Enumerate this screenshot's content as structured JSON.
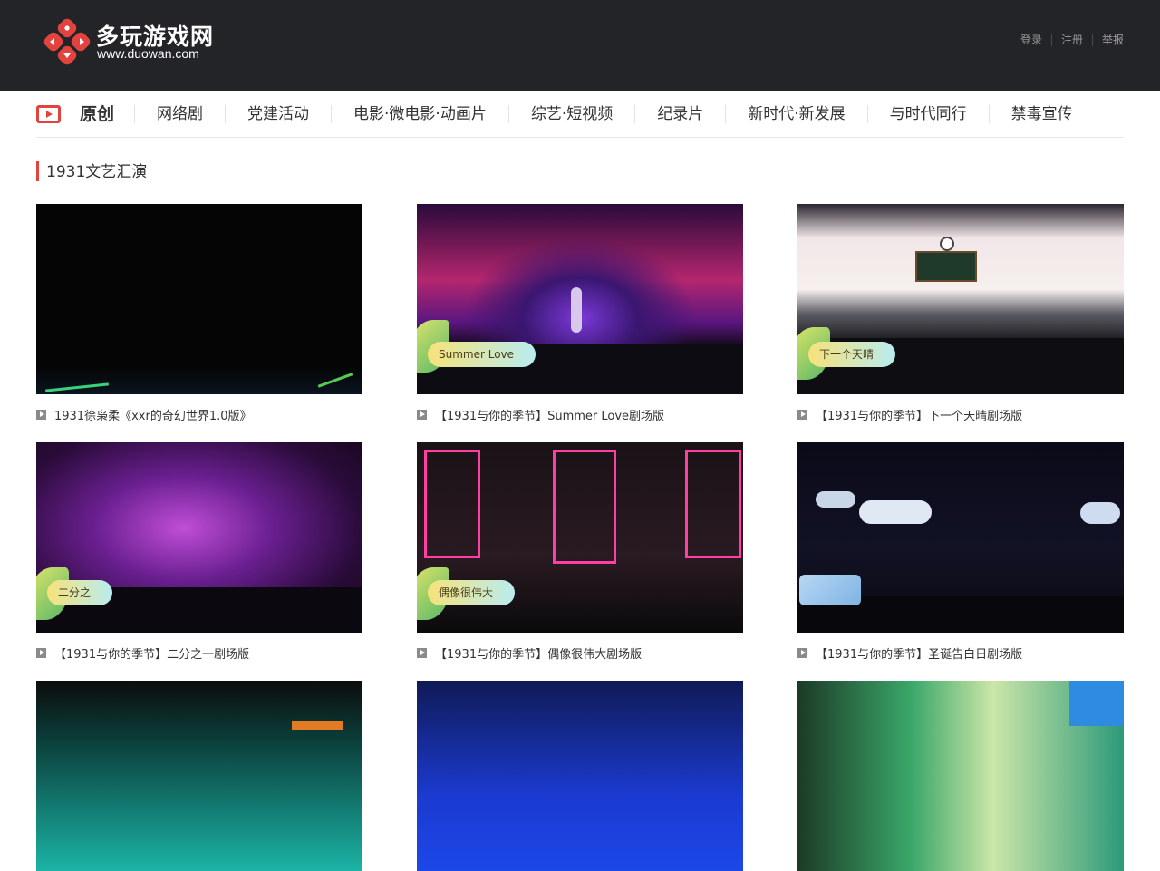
{
  "header": {
    "site_name": "多玩游戏网",
    "site_url": "www.duowan.com",
    "links": [
      "登录",
      "注册",
      "举报"
    ]
  },
  "nav": {
    "items": [
      "原创",
      "网络剧",
      "党建活动",
      "电影·微电影·动画片",
      "综艺·短视频",
      "纪录片",
      "新时代·新发展",
      "与时代同行",
      "禁毒宣传"
    ]
  },
  "section": {
    "title": "1931文艺汇演"
  },
  "videos": [
    {
      "title": "1931徐枭柔《xxr的奇幻世界1.0版》",
      "badge": ""
    },
    {
      "title": "【1931与你的季节】Summer Love剧场版",
      "badge": "Summer Love"
    },
    {
      "title": "【1931与你的季节】下一个天晴剧场版",
      "badge": "下一个天晴"
    },
    {
      "title": "【1931与你的季节】二分之一剧场版",
      "badge": "二分之"
    },
    {
      "title": "【1931与你的季节】偶像很伟大剧场版",
      "badge": "偶像很伟大"
    },
    {
      "title": "【1931与你的季节】圣诞告白日剧场版",
      "badge": ""
    }
  ],
  "colors": {
    "accent": "#e2433f",
    "header_bg": "#232428"
  }
}
